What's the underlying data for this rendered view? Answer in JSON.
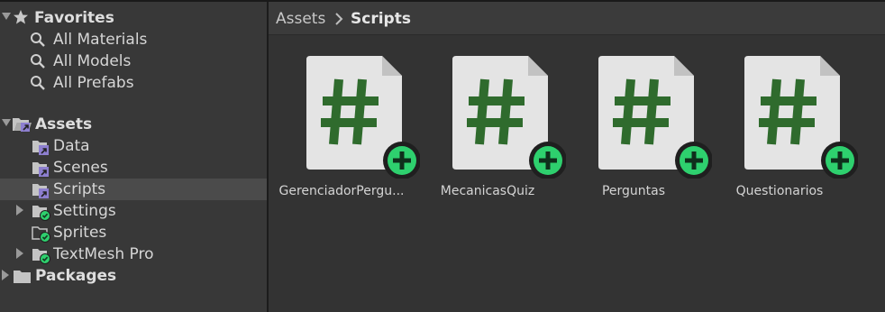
{
  "sidebar": {
    "favorites": {
      "label": "Favorites",
      "items": [
        {
          "label": "All Materials",
          "icon": "search-icon"
        },
        {
          "label": "All Models",
          "icon": "search-icon"
        },
        {
          "label": "All Prefabs",
          "icon": "search-icon"
        }
      ]
    },
    "assets": {
      "label": "Assets",
      "folders": [
        {
          "label": "Data",
          "icon": "folder-link-icon",
          "expandable": false,
          "selected": false
        },
        {
          "label": "Scenes",
          "icon": "folder-link-icon",
          "expandable": false,
          "selected": false
        },
        {
          "label": "Scripts",
          "icon": "folder-link-icon",
          "expandable": false,
          "selected": true
        },
        {
          "label": "Settings",
          "icon": "folder-check-icon",
          "expandable": true,
          "selected": false
        },
        {
          "label": "Sprites",
          "icon": "folder-check-icon",
          "expandable": false,
          "selected": false
        },
        {
          "label": "TextMesh Pro",
          "icon": "folder-check-icon",
          "expandable": true,
          "selected": false
        }
      ]
    },
    "packages": {
      "label": "Packages"
    }
  },
  "breadcrumb": {
    "root": "Assets",
    "current": "Scripts"
  },
  "files": [
    {
      "name": "GerenciadorPergu...",
      "icon": "csharp-script-add-icon"
    },
    {
      "name": "MecanicasQuiz",
      "icon": "csharp-script-add-icon"
    },
    {
      "name": "Perguntas",
      "icon": "csharp-script-add-icon"
    },
    {
      "name": "Questionarios",
      "icon": "csharp-script-add-icon"
    }
  ],
  "colors": {
    "panel": "#383838",
    "content": "#333333",
    "selection": "#4b4b4b",
    "hash_green": "#2f6b2d",
    "badge_green": "#2ed06e",
    "folder_link": "#8d7fcf"
  }
}
